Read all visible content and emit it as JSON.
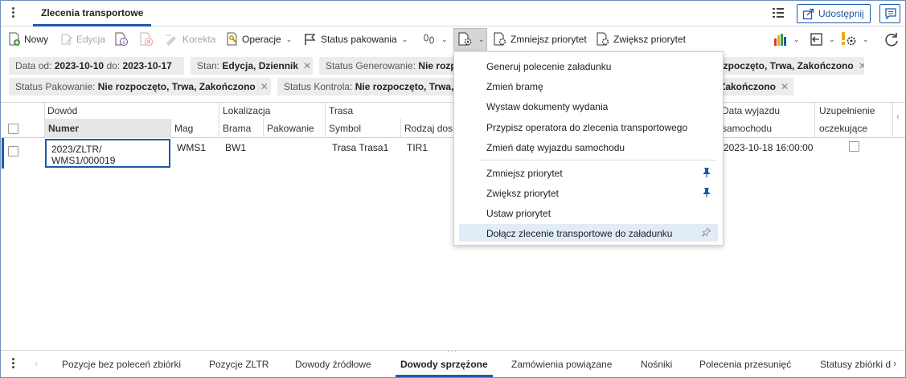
{
  "tab": {
    "title": "Zlecenia transportowe"
  },
  "header": {
    "share_label": "Udostępnij"
  },
  "toolbar": {
    "new_label": "Nowy",
    "edit_label": "Edycja",
    "correction_label": "Korekta",
    "operations_label": "Operacje",
    "packing_status_label": "Status pakowania",
    "decrease_priority_label": "Zmniejsz priorytet",
    "increase_priority_label": "Zwiększ priorytet"
  },
  "filters": [
    {
      "label": "Data",
      "value": "",
      "extra": "od: ",
      "v1": "2023-10-10",
      "extra2": " do: ",
      "v2": "2023-10-17",
      "removable": false
    },
    {
      "label": "Stan: ",
      "value": "Edycja, Dziennik",
      "removable": true
    },
    {
      "label": "Status  Generowanie: ",
      "value": "Nie rozpoczęto",
      "removable": false
    },
    {
      "label": "",
      "value": "rzpoczęto, Trwa, Zakończono",
      "removable": true
    },
    {
      "label": "Status  Pakowanie: ",
      "value": "Nie rozpoczęto, Trwa, Zakończono",
      "removable": true
    },
    {
      "label": "Status  Kontrola: ",
      "value": "Nie rozpoczęto, Trwa,",
      "removable": false
    },
    {
      "label": "",
      "value": "Zakończono",
      "removable": true
    }
  ],
  "grid": {
    "groups": {
      "dowod": "Dowód",
      "lokalizacja": "Lokalizacja",
      "trasa": "Trasa"
    },
    "columns": {
      "numer": "Numer",
      "mag": "Mag",
      "brama": "Brama",
      "pakowanie": "Pakowanie",
      "symbol": "Symbol",
      "rodzaj": "Rodzaj dos",
      "data_wyjazdu_1": "Data wyjazdu",
      "data_wyjazdu_2": "samochodu",
      "uzupelnienie_1": "Uzupełnienie",
      "uzupelnienie_2": "oczekujące"
    },
    "rows": [
      {
        "numer_1": "2023/ZLTR/",
        "numer_2": "WMS1/000019",
        "mag": "WMS1",
        "brama": "BW1",
        "symbol": "Trasa  Trasa1",
        "rodzaj": "TIR1",
        "data_wyjazdu": "2023-10-18 16:00:00"
      }
    ]
  },
  "menu": {
    "items": [
      "Generuj polecenie załadunku",
      "Zmień bramę",
      "Wystaw dokumenty wydania",
      "Przypisz operatora do zlecenia transportowego",
      "Zmień datę wyjazdu samochodu",
      "Zmniejsz priorytet",
      "Zwiększ priorytet",
      "Ustaw priorytet",
      "Dołącz zlecenie transportowe do załadunku"
    ]
  },
  "bottom_tabs": [
    "Pozycje bez poleceń zbiórki",
    "Pozycje ZLTR",
    "Dowody źródłowe",
    "Dowody sprzężone",
    "Zamówienia powiązane",
    "Nośniki",
    "Polecenia przesunięć",
    "Statusy zbiórki d"
  ],
  "colors": {
    "accent": "#1e5aa8",
    "menu_hover": "#e1ecf7",
    "chip_bg": "#ececec"
  }
}
